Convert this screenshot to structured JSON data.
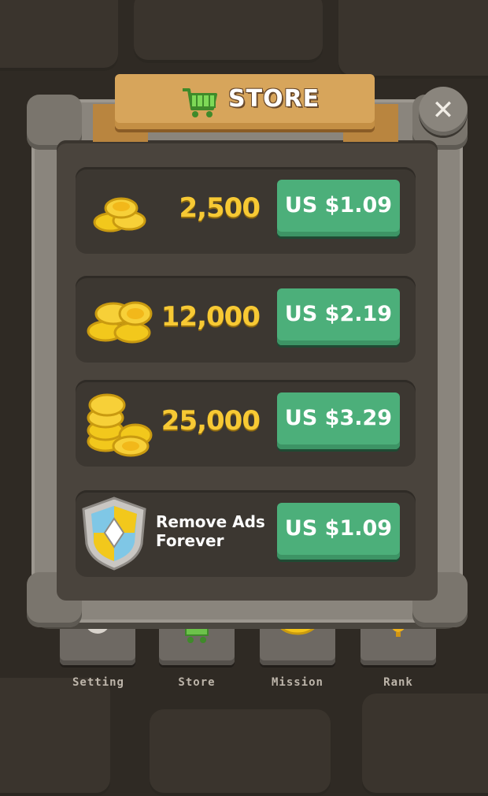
{
  "store": {
    "title": "STORE",
    "close_symbol": "✕",
    "items": [
      {
        "amount": "2,500",
        "price": "US $1.09",
        "icon": "small-coin-stack-icon"
      },
      {
        "amount": "12,000",
        "price": "US $2.19",
        "icon": "medium-coin-stack-icon"
      },
      {
        "amount": "25,000",
        "price": "US $3.29",
        "icon": "large-coin-stack-icon"
      },
      {
        "label": "Remove Ads\nForever",
        "price": "US $1.09",
        "icon": "shield-icon"
      }
    ]
  },
  "nav": {
    "items": [
      {
        "label": "Setting",
        "icon": "gear-icon"
      },
      {
        "label": "Store",
        "icon": "cart-icon"
      },
      {
        "label": "Mission",
        "icon": "coin-icon"
      },
      {
        "label": "Rank",
        "icon": "trophy-icon"
      }
    ]
  },
  "colors": {
    "coin": "#f7c934",
    "button_green": "#4caf7a",
    "ribbon": "#d7a55b",
    "frame_stone": "#8a857d"
  }
}
